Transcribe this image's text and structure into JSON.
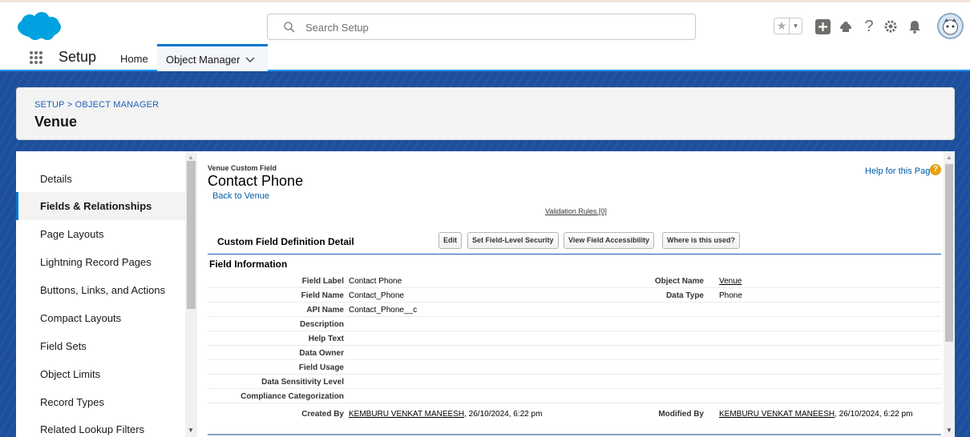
{
  "header": {
    "search_placeholder": "Search Setup"
  },
  "nav": {
    "app_name": "Setup",
    "home": "Home",
    "object_manager": "Object Manager"
  },
  "object_header": {
    "breadcrumb": "SETUP > OBJECT MANAGER",
    "title": "Venue"
  },
  "sidebar": {
    "items": [
      {
        "label": "Details",
        "active": false
      },
      {
        "label": "Fields & Relationships",
        "active": true
      },
      {
        "label": "Page Layouts",
        "active": false
      },
      {
        "label": "Lightning Record Pages",
        "active": false
      },
      {
        "label": "Buttons, Links, and Actions",
        "active": false
      },
      {
        "label": "Compact Layouts",
        "active": false
      },
      {
        "label": "Field Sets",
        "active": false
      },
      {
        "label": "Object Limits",
        "active": false
      },
      {
        "label": "Record Types",
        "active": false
      },
      {
        "label": "Related Lookup Filters",
        "active": false
      }
    ]
  },
  "content": {
    "pre_title": "Venue Custom Field",
    "title": "Contact Phone",
    "back_link": "Back to Venue",
    "help_link": "Help for this Page",
    "validation_link": "Validation Rules [0]",
    "detail_title": "Custom Field Definition Detail",
    "buttons": {
      "edit": "Edit",
      "fls": "Set Field-Level Security",
      "access": "View Field Accessibility",
      "where": "Where is this used?"
    },
    "section_title": "Field Information",
    "rows": [
      {
        "label": "Field Label",
        "value": "Contact Phone",
        "label2": "Object Name",
        "value2": "Venue"
      },
      {
        "label": "Field Name",
        "value": "Contact_Phone",
        "label2": "Data Type",
        "value2": "Phone"
      },
      {
        "label": "API Name",
        "value": "Contact_Phone__c",
        "label2": "",
        "value2": ""
      },
      {
        "label": "Description",
        "value": "",
        "label2": "",
        "value2": ""
      },
      {
        "label": "Help Text",
        "value": "",
        "label2": "",
        "value2": ""
      },
      {
        "label": "Data Owner",
        "value": "",
        "label2": "",
        "value2": ""
      },
      {
        "label": "Field Usage",
        "value": "",
        "label2": "",
        "value2": ""
      },
      {
        "label": "Data Sensitivity Level",
        "value": "",
        "label2": "",
        "value2": ""
      },
      {
        "label": "Compliance Categorization",
        "value": "",
        "label2": "",
        "value2": ""
      }
    ],
    "created": {
      "label": "Created By",
      "user": "KEMBURU VENKAT MANEESH",
      "date": ", 26/10/2024, 6:22 pm",
      "label2": "Modified By",
      "user2": "KEMBURU VENKAT MANEESH",
      "date2": ", 26/10/2024, 6:22 pm"
    }
  },
  "colors": {
    "brand_blue": "#0176d3",
    "band_blue": "#1d4f9c",
    "link_blue": "#015ba7"
  }
}
